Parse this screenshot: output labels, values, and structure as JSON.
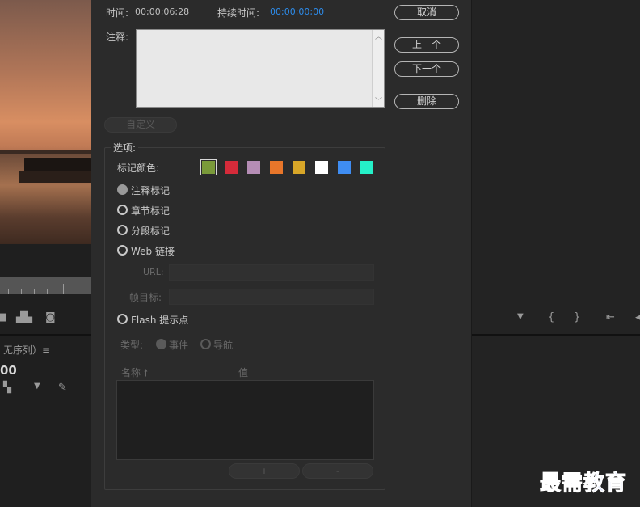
{
  "background": {
    "sequence_label": "无序列）≡",
    "timecode": "00"
  },
  "dialog": {
    "time_label": "时间:",
    "time_value": "00;00;06;28",
    "duration_label": "持续时间:",
    "duration_value": "00;00;00;00",
    "comment_label": "注释:",
    "comment_value": "",
    "buttons": {
      "cancel": "取消",
      "previous": "上一个",
      "next": "下一个",
      "delete": "删除",
      "custom": "自定义"
    },
    "options": {
      "title": "选项:",
      "marker_color_label": "标记颜色:",
      "colors": [
        "#7a9a3a",
        "#d52b3a",
        "#b58db5",
        "#e8762a",
        "#d8a628",
        "#ffffff",
        "#3f8df2",
        "#25f0c8"
      ],
      "marker_types": [
        {
          "label": "注释标记",
          "checked": true
        },
        {
          "label": "章节标记",
          "checked": false
        },
        {
          "label": "分段标记",
          "checked": false
        },
        {
          "label": "Web 链接",
          "checked": false
        }
      ],
      "url_label": "URL:",
      "frame_target_label": "帧目标:",
      "flash_label": "Flash 提示点",
      "type_label": "类型:",
      "type_event": "事件",
      "type_nav": "导航",
      "col_name": "名称",
      "col_value": "值",
      "add": "+",
      "remove": "-"
    }
  },
  "watermark": "最需教育"
}
